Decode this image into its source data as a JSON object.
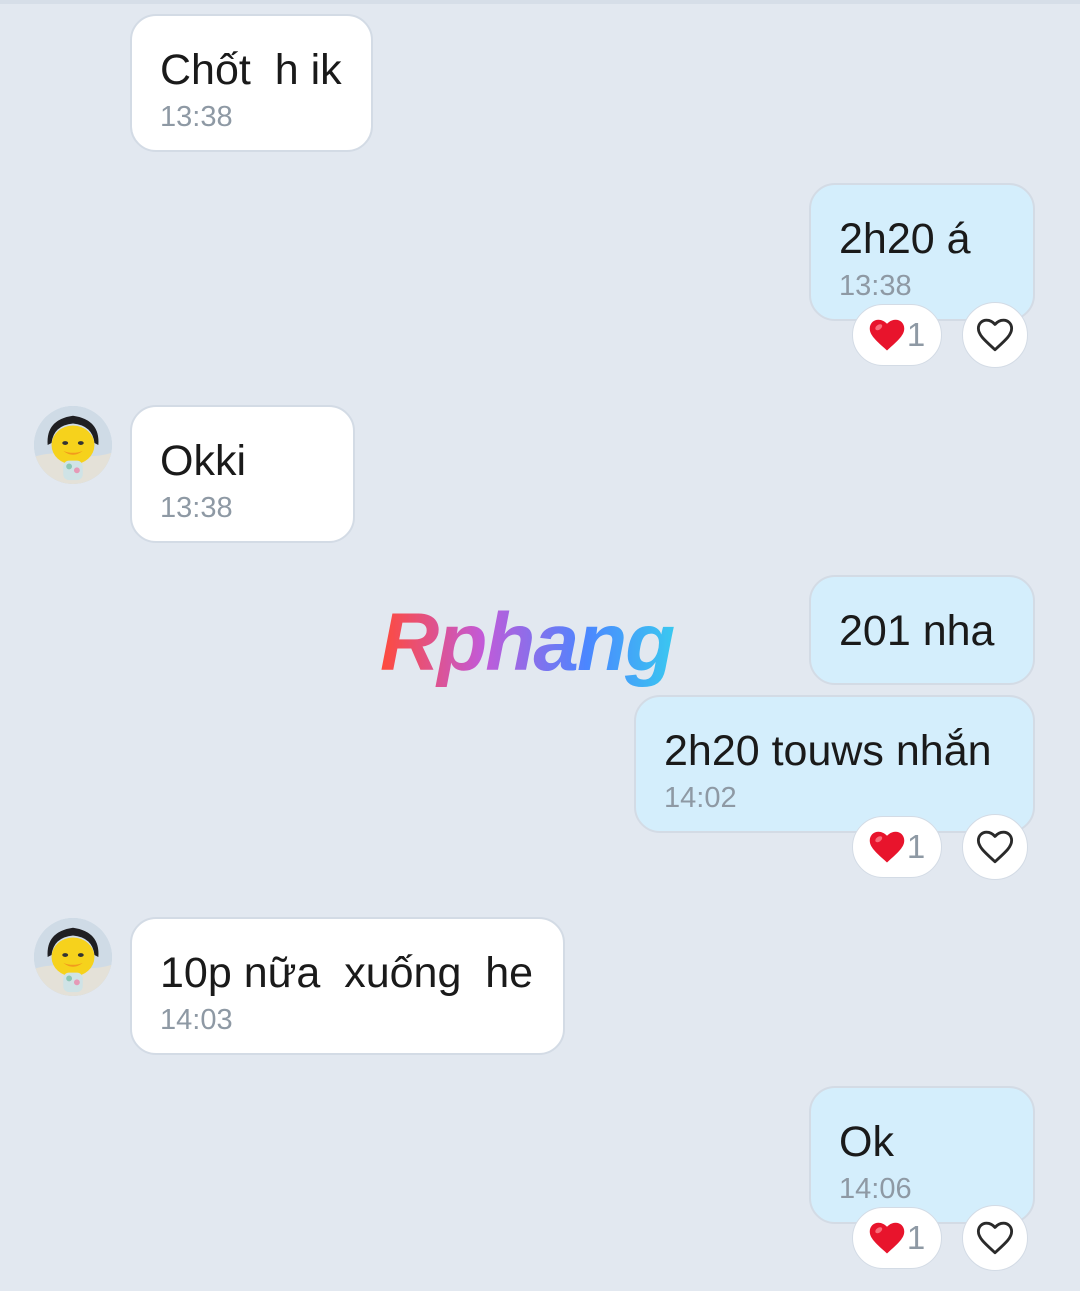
{
  "messages": [
    {
      "text": "Chốt  h ik",
      "time": "13:38"
    },
    {
      "text": "2h20 á",
      "time": "13:38",
      "reaction_count": "1"
    },
    {
      "text": "Okki",
      "time": "13:38"
    },
    {
      "text": "201 nha"
    },
    {
      "text": "2h20 touws nhắn",
      "time": "14:02",
      "reaction_count": "1"
    },
    {
      "text": "10p nữa  xuống  he",
      "time": "14:03"
    },
    {
      "text": "Ok",
      "time": "14:06",
      "reaction_count": "1"
    }
  ],
  "watermark": {
    "text": "Rphang"
  },
  "colors": {
    "background": "#e2e8f0",
    "incoming_bubble": "#ffffff",
    "outgoing_bubble": "#d4eefc",
    "timestamp": "#8e99a4",
    "heart": "#e8142c"
  },
  "icons": {
    "reaction": "red-heart-icon",
    "react_button": "heart-outline-icon",
    "avatar": "duck-avatar"
  }
}
